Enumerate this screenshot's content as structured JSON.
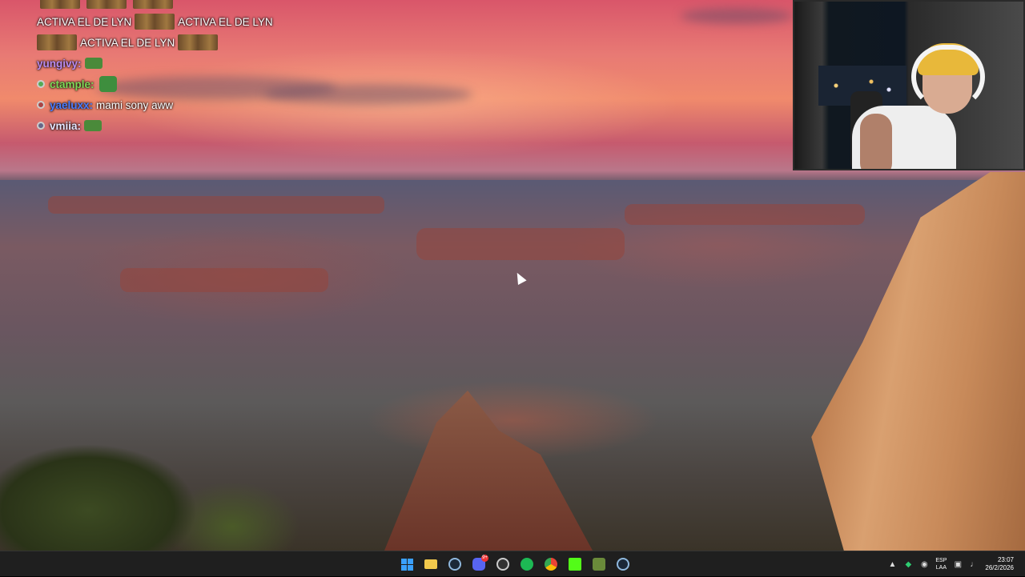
{
  "chat": {
    "lines": [
      {
        "text": "ACTIVA EL DE LYN"
      },
      {
        "text": "ACTIVA EL DE LYN"
      },
      {
        "text": "ACTIVA EL DE LYN"
      },
      {
        "user": "yungivy:",
        "user_color": "#b98bf0"
      },
      {
        "user": "ctample:",
        "user_color": "#7ed957"
      },
      {
        "user": "yaeluxx:",
        "user_color": "#4a7dff",
        "message": "mami sony aww"
      },
      {
        "user": "vmiia:",
        "user_color": "#e6e6ff"
      }
    ]
  },
  "webcam": {
    "label": "streamer-webcam"
  },
  "taskbar": {
    "apps": [
      "start",
      "file-explorer",
      "steam",
      "discord",
      "obs-studio",
      "spotify",
      "chrome",
      "kick",
      "game-launcher",
      "steam-2"
    ],
    "discord_badge": "9+",
    "language": {
      "line1": "ESP",
      "line2": "LAA"
    },
    "time": "23:07",
    "date": "26/2/2026"
  },
  "colors": {
    "taskbar_bg": "#1f1f1f",
    "accent": "#3aa0ff",
    "spotify": "#1db954",
    "kick": "#53fc18"
  }
}
